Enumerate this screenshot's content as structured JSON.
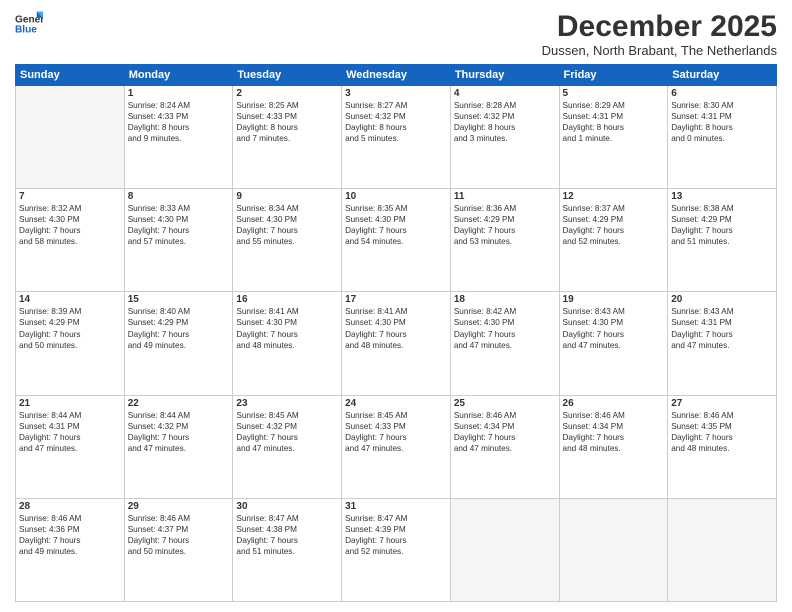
{
  "logo": {
    "line1": "General",
    "line2": "Blue"
  },
  "title": "December 2025",
  "subtitle": "Dussen, North Brabant, The Netherlands",
  "header_days": [
    "Sunday",
    "Monday",
    "Tuesday",
    "Wednesday",
    "Thursday",
    "Friday",
    "Saturday"
  ],
  "weeks": [
    [
      {
        "day": "",
        "info": ""
      },
      {
        "day": "1",
        "info": "Sunrise: 8:24 AM\nSunset: 4:33 PM\nDaylight: 8 hours\nand 9 minutes."
      },
      {
        "day": "2",
        "info": "Sunrise: 8:25 AM\nSunset: 4:33 PM\nDaylight: 8 hours\nand 7 minutes."
      },
      {
        "day": "3",
        "info": "Sunrise: 8:27 AM\nSunset: 4:32 PM\nDaylight: 8 hours\nand 5 minutes."
      },
      {
        "day": "4",
        "info": "Sunrise: 8:28 AM\nSunset: 4:32 PM\nDaylight: 8 hours\nand 3 minutes."
      },
      {
        "day": "5",
        "info": "Sunrise: 8:29 AM\nSunset: 4:31 PM\nDaylight: 8 hours\nand 1 minute."
      },
      {
        "day": "6",
        "info": "Sunrise: 8:30 AM\nSunset: 4:31 PM\nDaylight: 8 hours\nand 0 minutes."
      }
    ],
    [
      {
        "day": "7",
        "info": "Sunrise: 8:32 AM\nSunset: 4:30 PM\nDaylight: 7 hours\nand 58 minutes."
      },
      {
        "day": "8",
        "info": "Sunrise: 8:33 AM\nSunset: 4:30 PM\nDaylight: 7 hours\nand 57 minutes."
      },
      {
        "day": "9",
        "info": "Sunrise: 8:34 AM\nSunset: 4:30 PM\nDaylight: 7 hours\nand 55 minutes."
      },
      {
        "day": "10",
        "info": "Sunrise: 8:35 AM\nSunset: 4:30 PM\nDaylight: 7 hours\nand 54 minutes."
      },
      {
        "day": "11",
        "info": "Sunrise: 8:36 AM\nSunset: 4:29 PM\nDaylight: 7 hours\nand 53 minutes."
      },
      {
        "day": "12",
        "info": "Sunrise: 8:37 AM\nSunset: 4:29 PM\nDaylight: 7 hours\nand 52 minutes."
      },
      {
        "day": "13",
        "info": "Sunrise: 8:38 AM\nSunset: 4:29 PM\nDaylight: 7 hours\nand 51 minutes."
      }
    ],
    [
      {
        "day": "14",
        "info": "Sunrise: 8:39 AM\nSunset: 4:29 PM\nDaylight: 7 hours\nand 50 minutes."
      },
      {
        "day": "15",
        "info": "Sunrise: 8:40 AM\nSunset: 4:29 PM\nDaylight: 7 hours\nand 49 minutes."
      },
      {
        "day": "16",
        "info": "Sunrise: 8:41 AM\nSunset: 4:30 PM\nDaylight: 7 hours\nand 48 minutes."
      },
      {
        "day": "17",
        "info": "Sunrise: 8:41 AM\nSunset: 4:30 PM\nDaylight: 7 hours\nand 48 minutes."
      },
      {
        "day": "18",
        "info": "Sunrise: 8:42 AM\nSunset: 4:30 PM\nDaylight: 7 hours\nand 47 minutes."
      },
      {
        "day": "19",
        "info": "Sunrise: 8:43 AM\nSunset: 4:30 PM\nDaylight: 7 hours\nand 47 minutes."
      },
      {
        "day": "20",
        "info": "Sunrise: 8:43 AM\nSunset: 4:31 PM\nDaylight: 7 hours\nand 47 minutes."
      }
    ],
    [
      {
        "day": "21",
        "info": "Sunrise: 8:44 AM\nSunset: 4:31 PM\nDaylight: 7 hours\nand 47 minutes."
      },
      {
        "day": "22",
        "info": "Sunrise: 8:44 AM\nSunset: 4:32 PM\nDaylight: 7 hours\nand 47 minutes."
      },
      {
        "day": "23",
        "info": "Sunrise: 8:45 AM\nSunset: 4:32 PM\nDaylight: 7 hours\nand 47 minutes."
      },
      {
        "day": "24",
        "info": "Sunrise: 8:45 AM\nSunset: 4:33 PM\nDaylight: 7 hours\nand 47 minutes."
      },
      {
        "day": "25",
        "info": "Sunrise: 8:46 AM\nSunset: 4:34 PM\nDaylight: 7 hours\nand 47 minutes."
      },
      {
        "day": "26",
        "info": "Sunrise: 8:46 AM\nSunset: 4:34 PM\nDaylight: 7 hours\nand 48 minutes."
      },
      {
        "day": "27",
        "info": "Sunrise: 8:46 AM\nSunset: 4:35 PM\nDaylight: 7 hours\nand 48 minutes."
      }
    ],
    [
      {
        "day": "28",
        "info": "Sunrise: 8:46 AM\nSunset: 4:36 PM\nDaylight: 7 hours\nand 49 minutes."
      },
      {
        "day": "29",
        "info": "Sunrise: 8:46 AM\nSunset: 4:37 PM\nDaylight: 7 hours\nand 50 minutes."
      },
      {
        "day": "30",
        "info": "Sunrise: 8:47 AM\nSunset: 4:38 PM\nDaylight: 7 hours\nand 51 minutes."
      },
      {
        "day": "31",
        "info": "Sunrise: 8:47 AM\nSunset: 4:39 PM\nDaylight: 7 hours\nand 52 minutes."
      },
      {
        "day": "",
        "info": ""
      },
      {
        "day": "",
        "info": ""
      },
      {
        "day": "",
        "info": ""
      }
    ]
  ]
}
